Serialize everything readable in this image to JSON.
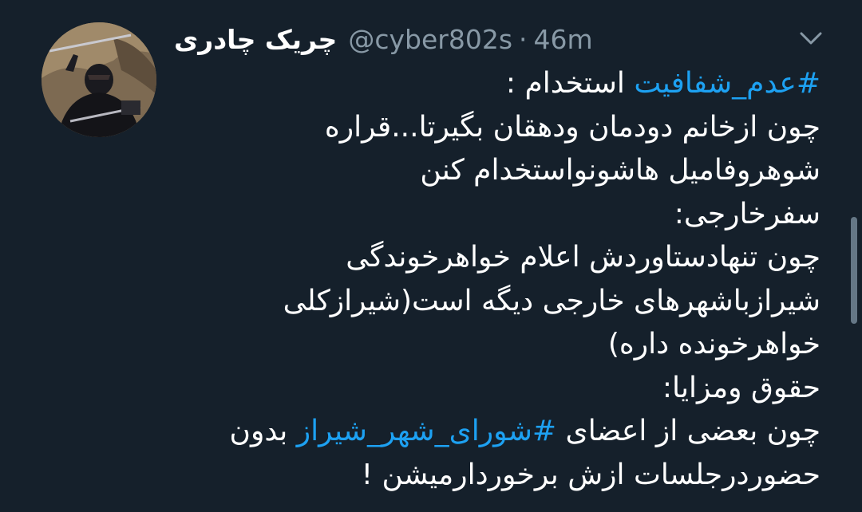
{
  "tweet": {
    "display_name": "چریک چادری",
    "handle": "@cyber802s",
    "separator": "·",
    "time": "46m",
    "avatar_icon": "user-avatar-masked-figure",
    "menu_icon": "chevron-down-icon",
    "body": {
      "l1_tag": "#عدم_شفافیت",
      "l1_text": " استخدام :",
      "l2": "چون ازخانم دودمان ودهقان بگیرتا...قراره",
      "l3": "شوهروفامیل هاشونواستخدام کنن",
      "l4": "سفرخارجی:",
      "l5": "چون تنهادستاوردش اعلام خواهرخوندگی",
      "l6": "شیرازباشهرهای خارجی دیگه است(شیرازکلی",
      "l7": "خواهرخونده داره)",
      "l8": "حقوق ومزایا:",
      "l9_pre": "چون بعضی از اعضای ",
      "l9_tag": "#شورای_شهر_شیراز",
      "l9_post": " بدون",
      "l10": "حضوردرجلسات ازش برخوردارمیشن !"
    }
  },
  "colors": {
    "background": "#15202b",
    "text": "#ffffff",
    "secondary": "#8899a6",
    "link": "#1da1f2"
  }
}
